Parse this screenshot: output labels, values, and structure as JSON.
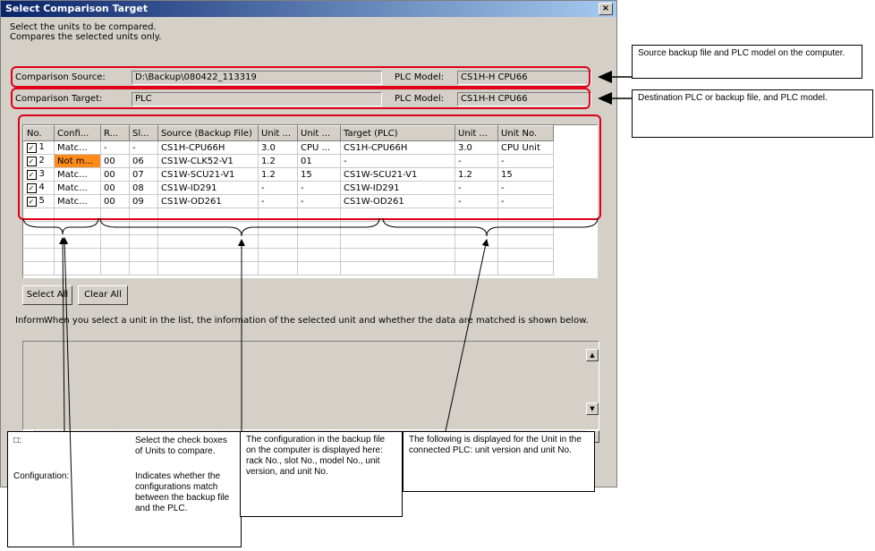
{
  "dialog": {
    "title": "Select Comparison Target",
    "close_label": "×",
    "instructions": [
      "Select the units to be compared.",
      "Compares the selected units only."
    ]
  },
  "source": {
    "label": "Comparison Source:",
    "value": "D:\\Backup\\080422_113319",
    "plc_label": "PLC Model:",
    "plc_value": "CS1H-H CPU66"
  },
  "target": {
    "label": "Comparison Target:",
    "value": "PLC",
    "plc_label": "PLC Model:",
    "plc_value": "CS1H-H CPU66"
  },
  "table": {
    "columns": [
      "No.",
      "Confi...",
      "R...",
      "Sl...",
      "Source (Backup File)",
      "Unit ...",
      "Unit ...",
      "Target (PLC)",
      "Unit ...",
      "Unit No."
    ],
    "rows": [
      {
        "no": "1",
        "confi": "Matc...",
        "r": "-",
        "sl": "-",
        "source": "CS1H-CPU66H",
        "uver": "3.0",
        "uno": "CPU ...",
        "target": "CS1H-CPU66H",
        "tver": "3.0",
        "tno": "CPU Unit",
        "checked": true,
        "mismatch": false
      },
      {
        "no": "2",
        "confi": "Not m...",
        "r": "00",
        "sl": "06",
        "source": "CS1W-CLK52-V1",
        "uver": "1.2",
        "uno": "01",
        "target": "-",
        "tver": "-",
        "tno": "-",
        "checked": true,
        "mismatch": true
      },
      {
        "no": "3",
        "confi": "Matc...",
        "r": "00",
        "sl": "07",
        "source": "CS1W-SCU21-V1",
        "uver": "1.2",
        "uno": "15",
        "target": "CS1W-SCU21-V1",
        "tver": "1.2",
        "tno": "15",
        "checked": true,
        "mismatch": false
      },
      {
        "no": "4",
        "confi": "Matc...",
        "r": "00",
        "sl": "08",
        "source": "CS1W-ID291",
        "uver": "-",
        "uno": "-",
        "target": "CS1W-ID291",
        "tver": "-",
        "tno": "-",
        "checked": true,
        "mismatch": false
      },
      {
        "no": "5",
        "confi": "Matc...",
        "r": "00",
        "sl": "09",
        "source": "CS1W-OD261",
        "uver": "-",
        "uno": "-",
        "target": "CS1W-OD261",
        "tver": "-",
        "tno": "-",
        "checked": true,
        "mismatch": false
      }
    ],
    "check_mark": "✓"
  },
  "buttons": {
    "select_all": "Select All",
    "clear_all": "Clear All"
  },
  "info": {
    "label": "Inform",
    "text": "When you select a unit in the list, the information of the selected unit and whether the data are matched is shown below."
  },
  "scroll": {
    "up": "▲",
    "down": "▼",
    "left": "◀",
    "right": "▶"
  },
  "callouts": {
    "source": "Source backup file and PLC model on the computer.",
    "target": "Destination PLC or backup file, and PLC model.",
    "legend": {
      "check_term": "□:",
      "check_desc": "Select the check boxes of Units to compare.",
      "config_term": "Configuration:",
      "config_desc": "Indicates whether the configurations match between the backup file and the PLC."
    },
    "backup": "The configuration in the backup file on the computer is displayed here: rack No., slot No., model No., unit version, and unit No.",
    "plc": "The following is displayed for the Unit in the connected PLC: unit version and unit No."
  },
  "colors": {
    "highlight": "#e0001a",
    "mismatch": "#ff8c1a",
    "titlebar": "#0a246a"
  }
}
